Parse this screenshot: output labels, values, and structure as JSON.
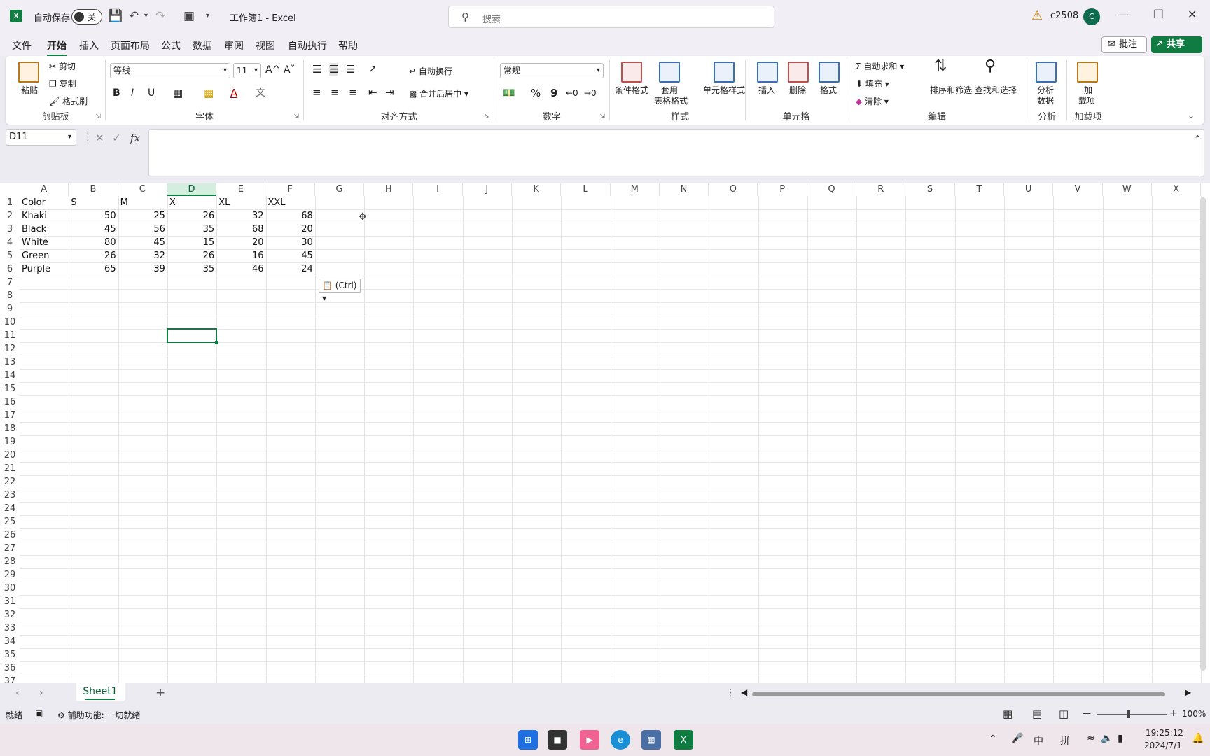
{
  "titlebar": {
    "app_icon": "X",
    "autosave_label": "自动保存",
    "autosave_state": "关",
    "doc_title": "工作簿1 - Excel",
    "search_placeholder": "搜索",
    "user_name": "c2508",
    "avatar_letter": "C"
  },
  "menu": {
    "items": [
      "文件",
      "开始",
      "插入",
      "页面布局",
      "公式",
      "数据",
      "审阅",
      "视图",
      "自动执行",
      "帮助"
    ],
    "active": "开始",
    "comment_label": "批注",
    "share_label": "共享"
  },
  "ribbon": {
    "clipboard": {
      "paste": "粘贴",
      "cut": "剪切",
      "copy": "复制",
      "format_painter": "格式刷",
      "title": "剪贴板"
    },
    "font": {
      "font_name": "等线",
      "font_size": "11",
      "bold": "B",
      "italic": "I",
      "underline": "U",
      "grow": "A^",
      "shrink": "A˅",
      "font_color": "A",
      "title": "字体"
    },
    "alignment": {
      "wrap": "自动换行",
      "merge": "合并后居中",
      "title": "对齐方式"
    },
    "number": {
      "format": "常规",
      "percent": "%",
      "comma": "9",
      "title": "数字"
    },
    "styles": {
      "conditional": "条件格式",
      "table": "套用",
      "table2": "表格格式",
      "cell": "单元格样式",
      "title": "样式"
    },
    "cells": {
      "insert": "插入",
      "delete": "删除",
      "format": "格式",
      "title": "单元格"
    },
    "editing": {
      "autosum": "自动求和",
      "fill": "填充",
      "clear": "清除",
      "sort": "排序和筛选",
      "find": "查找和选择",
      "title": "编辑"
    },
    "analysis": {
      "analyze": "分析",
      "analyze2": "数据",
      "title": "分析"
    },
    "addins": {
      "addin": "加",
      "addin2": "载项",
      "title": "加载项"
    }
  },
  "formula_bar": {
    "name_box": "D11",
    "fx": "fx",
    "content": ""
  },
  "grid": {
    "columns": [
      "A",
      "B",
      "C",
      "D",
      "E",
      "F",
      "G",
      "H",
      "I",
      "J",
      "K",
      "L",
      "M",
      "N",
      "O",
      "P",
      "Q",
      "R",
      "S",
      "T",
      "U",
      "V",
      "W",
      "X"
    ],
    "selected_column": "D",
    "selected_cell": "D11",
    "rows": [
      "1",
      "2",
      "3",
      "4",
      "5",
      "6",
      "7",
      "8",
      "9",
      "10",
      "11",
      "12",
      "13",
      "14",
      "15",
      "16",
      "17",
      "18",
      "19",
      "20",
      "21",
      "22",
      "23",
      "24",
      "25",
      "26",
      "27",
      "28",
      "29",
      "30",
      "31",
      "32",
      "33",
      "34",
      "35",
      "36",
      "37"
    ],
    "header_row": [
      "Color",
      "S",
      "M",
      "X",
      "XL",
      "XXL"
    ],
    "data": [
      [
        "Khaki",
        "50",
        "25",
        "26",
        "32",
        "68"
      ],
      [
        "Black",
        "45",
        "56",
        "35",
        "68",
        "20"
      ],
      [
        "White",
        "80",
        "45",
        "15",
        "20",
        "30"
      ],
      [
        "Green",
        "26",
        "32",
        "26",
        "16",
        "45"
      ],
      [
        "Purple",
        "65",
        "39",
        "35",
        "46",
        "24"
      ]
    ],
    "paste_options": "(Ctrl)"
  },
  "sheets": {
    "tabs": [
      "Sheet1"
    ],
    "add": "+"
  },
  "status": {
    "ready": "就绪",
    "accessibility": "辅助功能: 一切就绪",
    "zoom": "100%"
  },
  "taskbar": {
    "time": "19:25:12",
    "date": "2024/7/1",
    "ime1": "中",
    "ime2": "拼"
  }
}
